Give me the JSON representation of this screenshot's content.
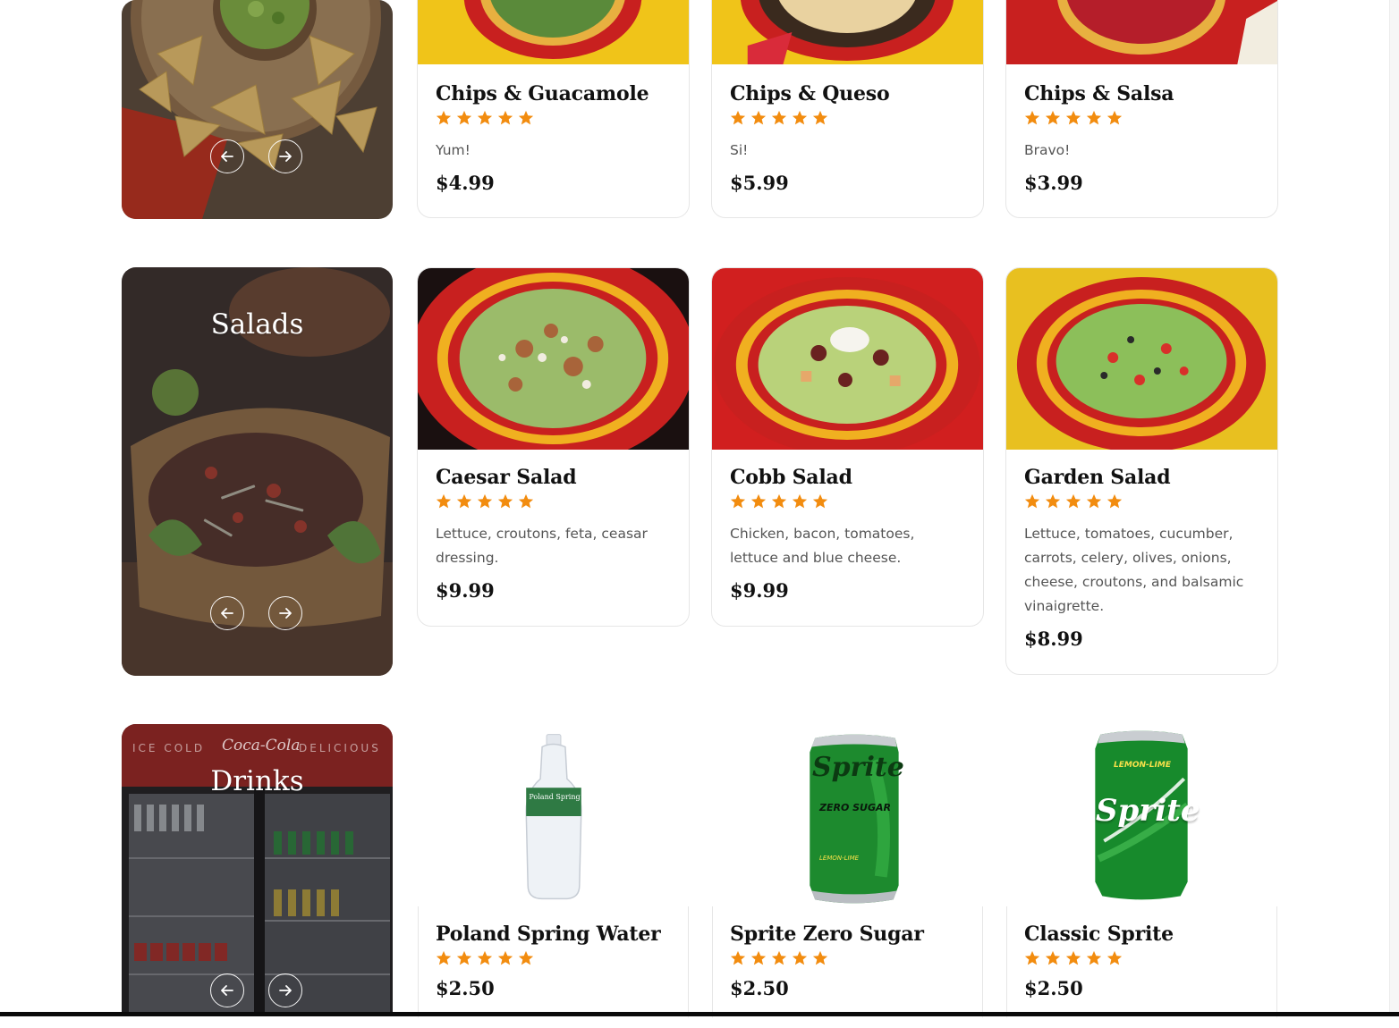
{
  "colors": {
    "star": "#f28c0f",
    "accent_yellow": "#f0c419",
    "accent_red": "#c8201f"
  },
  "sections": {
    "chips": {
      "items": [
        {
          "name": "Chips & Guacamole",
          "rating": 5,
          "description": "Yum!",
          "price": "$4.99"
        },
        {
          "name": "Chips & Queso",
          "rating": 5,
          "description": "Si!",
          "price": "$5.99"
        },
        {
          "name": "Chips & Salsa",
          "rating": 5,
          "description": "Bravo!",
          "price": "$3.99"
        }
      ]
    },
    "salads": {
      "title": "Salads",
      "items": [
        {
          "name": "Caesar Salad",
          "rating": 5,
          "description": "Lettuce, croutons, feta, ceasar dressing.",
          "price": "$9.99"
        },
        {
          "name": "Cobb Salad",
          "rating": 5,
          "description": "Chicken, bacon, tomatoes, lettuce and blue cheese.",
          "price": "$9.99"
        },
        {
          "name": "Garden Salad",
          "rating": 5,
          "description": "Lettuce, tomatoes, cucumber, carrots, celery, olives, onions, cheese, croutons, and balsamic vinaigrette.",
          "price": "$8.99"
        }
      ]
    },
    "drinks": {
      "title": "Drinks",
      "banner_left": "ICE COLD",
      "banner_brand": "Coca-Cola",
      "banner_right": "DELICIOUS",
      "items": [
        {
          "name": "Poland Spring Water",
          "rating": 5,
          "price": "$2.50",
          "label": "Poland Spring"
        },
        {
          "name": "Sprite Zero Sugar",
          "rating": 5,
          "price": "$2.50",
          "label": "Sprite",
          "sublabel": "ZERO SUGAR",
          "flavor": "LEMON-LIME"
        },
        {
          "name": "Classic Sprite",
          "rating": 5,
          "price": "$2.50",
          "label": "Sprite",
          "flavor": "LEMON-LIME"
        }
      ]
    }
  }
}
